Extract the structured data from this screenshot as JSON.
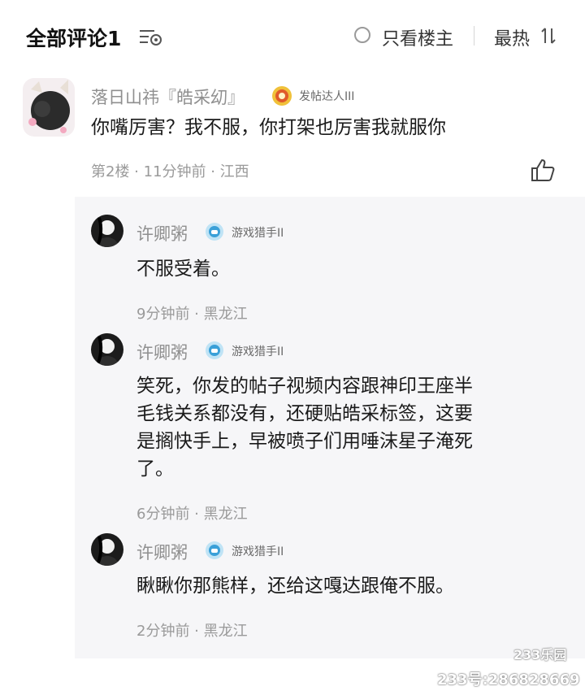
{
  "header": {
    "title": "全部评论1",
    "filter_icon": "list-filter-icon",
    "only_op_label": "只看楼主",
    "sort_label": "最热",
    "sort_icon": "sort-arrows-icon"
  },
  "comment": {
    "author": "落日山祎『皓采㓜』",
    "badge": "发帖达人III",
    "badge_icon": "badge-medal-icon",
    "text": "你嘴厉害？我不服，你打架也厉害我就服你",
    "meta": "第2楼 · 11分钟前 · 江西",
    "like_icon": "thumbs-up-icon"
  },
  "replies": [
    {
      "author": "许卿粥",
      "badge": "游戏猎手II",
      "text": "不服受着。",
      "meta": "9分钟前 · 黑龙江"
    },
    {
      "author": "许卿粥",
      "badge": "游戏猎手II",
      "text_lines": [
        "笑死，你发的帖子视频内容跟神印王座半",
        "毛钱关系都没有，还硬贴皓采标签，这要",
        "是搁快手上，早被喷子们用唾沫星子淹死",
        "了。"
      ],
      "meta": "6分钟前 · 黑龙江"
    },
    {
      "author": "许卿粥",
      "badge": "游戏猎手II",
      "text": "瞅瞅你那熊样，还给这嘎达跟俺不服。",
      "meta": "2分钟前 · 黑龙江"
    }
  ],
  "watermark": {
    "logo": "233乐园",
    "id_line": "233号:286828669"
  },
  "colors": {
    "reply_background": "#f6f6f8",
    "meta_gray": "#9a9a9a",
    "badge_blue": "#3aa0d8"
  }
}
